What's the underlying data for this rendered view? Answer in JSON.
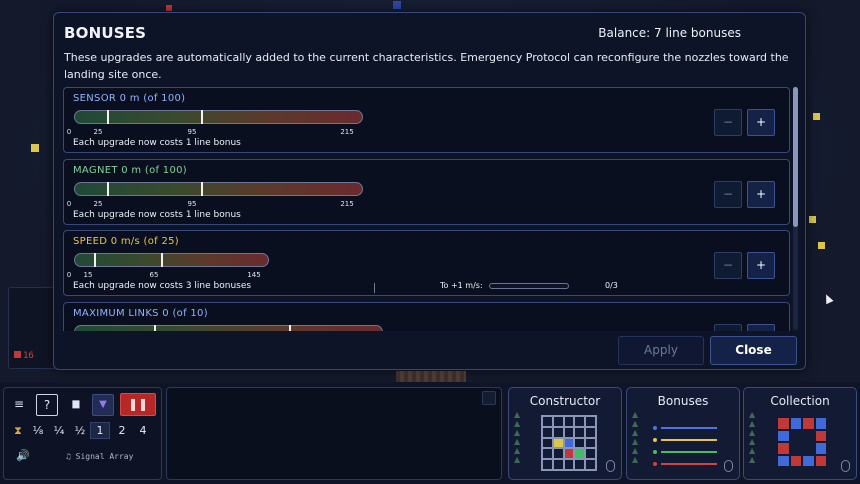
{
  "scene": {
    "left_counter": "16"
  },
  "modal": {
    "title": "BONUSES",
    "balance": "Balance: 7 line bonuses",
    "description": "These upgrades are automatically added to the current characteristics. Emergency Protocol can reconfigure the nozzles toward the landing site once.",
    "items": [
      {
        "name": "SENSOR  0 m (of 100)",
        "color": "#8fb3ff",
        "ticks": [
          "0",
          "25",
          "95",
          "215"
        ],
        "cost": "Each upgrade now costs 1 line bonus",
        "minus": "−",
        "plus": "+"
      },
      {
        "name": "MAGNET  0 m (of 100)",
        "color": "#7fd49a",
        "ticks": [
          "0",
          "25",
          "95",
          "215"
        ],
        "cost": "Each upgrade now costs 1 line bonus",
        "minus": "−",
        "plus": "+"
      },
      {
        "name": "SPEED  0 m/s (of 25)",
        "color": "#e6c34d",
        "ticks": [
          "0",
          "15",
          "65",
          "145"
        ],
        "cost": "Each upgrade now costs 3 line bonuses",
        "progress_label": "To +1 m/s:",
        "progress_value": 0,
        "progress_count": "0/3",
        "minus": "−",
        "plus": "+"
      },
      {
        "name": "MAXIMUM LINKS  0 (of 10)",
        "color": "#8fb3ff"
      }
    ],
    "apply_label": "Apply",
    "close_label": "Close"
  },
  "toolbar": {
    "menu_icon": "≡",
    "help_label": "?",
    "stats_icon": "▆",
    "filter_icon": "▼",
    "pause_icon": "❚❚",
    "timer_icon": "⧗",
    "speeds": [
      "⅛",
      "¼",
      "½",
      "1",
      "2",
      "4"
    ],
    "selected_speed": "1",
    "sound_icon": "🔊",
    "signal_label": "♫ Signal Array"
  },
  "cards": {
    "constructor": "Constructor",
    "bonuses": "Bonuses",
    "collection": "Collection",
    "bonus_line_colors": [
      "#4d73e0",
      "#e6c34d",
      "#3fbf5f",
      "#d24242"
    ]
  }
}
